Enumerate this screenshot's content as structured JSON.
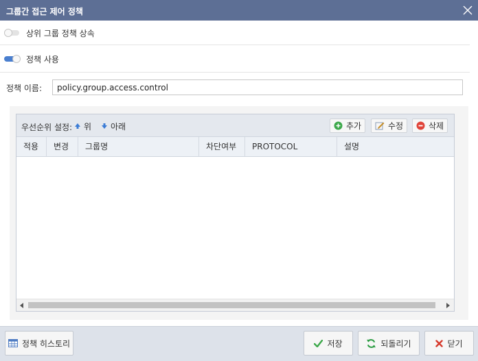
{
  "dialog": {
    "title": "그룹간 접근 제어 정책",
    "inherit_toggle": {
      "label": "상위 그룹 정책 상속",
      "state": "off"
    },
    "use_toggle": {
      "label": "정책 사용",
      "state": "on"
    },
    "policy_name": {
      "label": "정책 이름:",
      "value": "policy.group.access.control"
    }
  },
  "grid": {
    "toolbar": {
      "priority_label": "우선순위 설정:",
      "up_label": "위",
      "down_label": "아래",
      "add_label": "추가",
      "edit_label": "수정",
      "delete_label": "삭제"
    },
    "columns": [
      "적용",
      "변경",
      "그룹명",
      "차단여부",
      "PROTOCOL",
      "설명"
    ],
    "rows": []
  },
  "footer": {
    "history_label": "정책 히스토리",
    "save_label": "저장",
    "revert_label": "되돌리기",
    "close_label": "닫기"
  },
  "colors": {
    "titlebar": "#5d6f95",
    "toggle_on": "#4a7fcf",
    "add_icon": "#3ca84a",
    "delete_icon": "#e0443a",
    "save_icon": "#3ca84a",
    "revert_icon": "#2e9d45",
    "close_icon": "#d63a2c"
  }
}
